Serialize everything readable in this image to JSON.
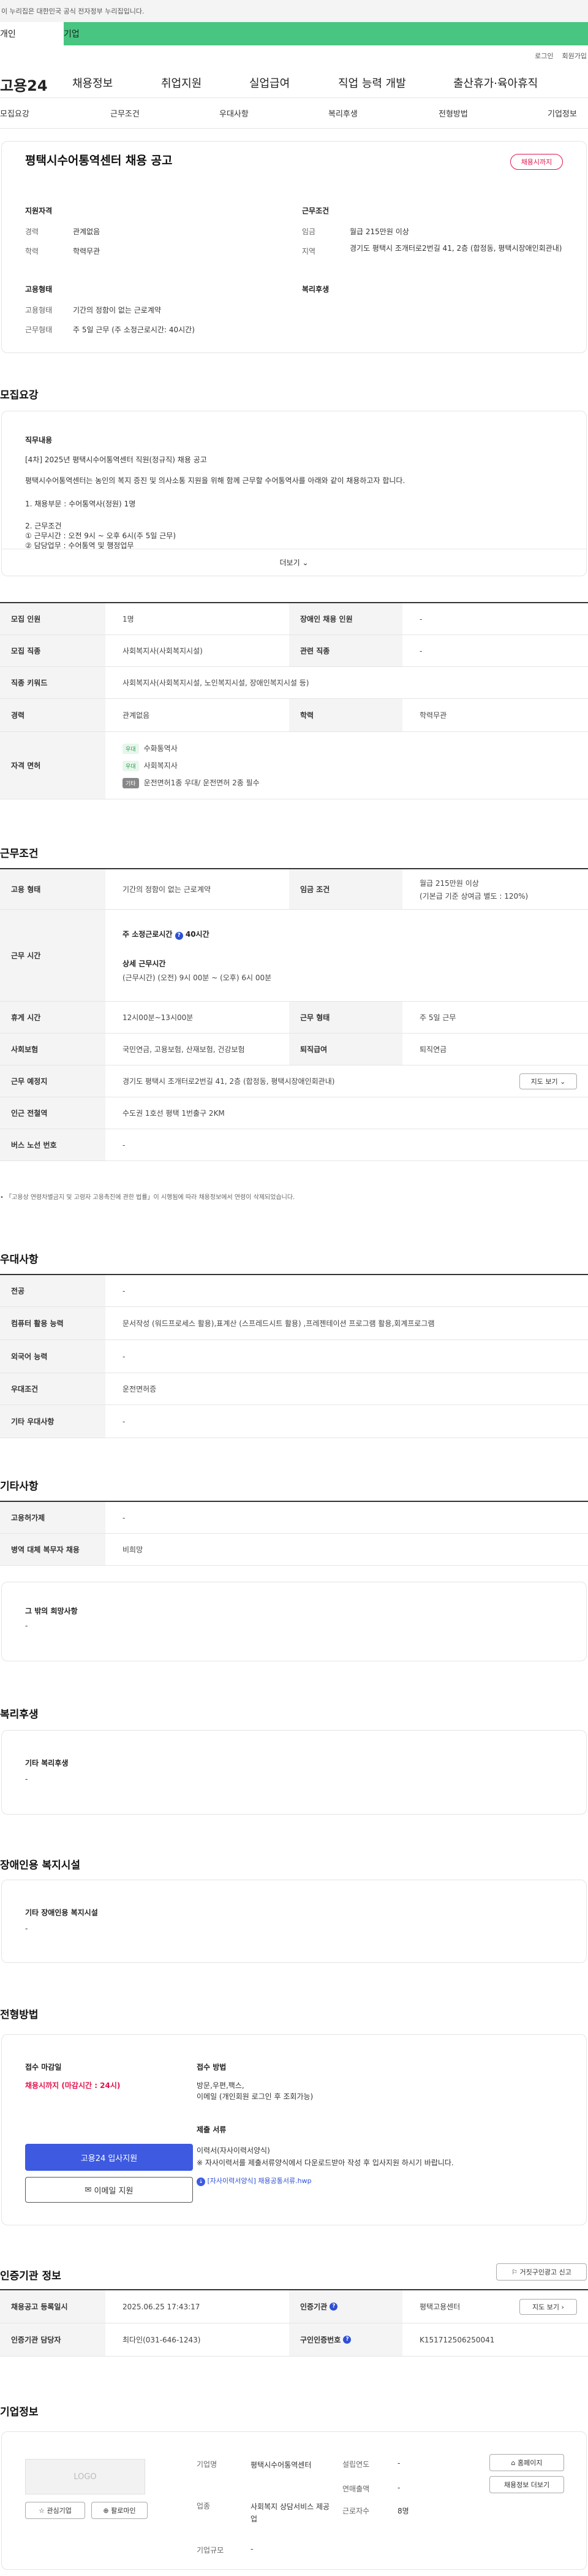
{
  "topbar": {
    "notice": "이 누리집은 대한민국 공식 전자정부 누리집입니다.",
    "tabs": [
      "개인",
      "기업"
    ],
    "login": "로그인",
    "join": "회원가입"
  },
  "gnb": {
    "logo": "고용24",
    "menus": [
      "채용정보",
      "취업지원",
      "실업급여",
      "직업 능력 개발",
      "출산휴가·육아휴직"
    ]
  },
  "lnb": [
    "모집요강",
    "근무조건",
    "우대사항",
    "복리후생",
    "전형방법",
    "기업정보"
  ],
  "job": {
    "title": "평택시수어통역센터 채용 공고",
    "badge": "채용시까지",
    "qual_title": "지원자격",
    "career_label": "경력",
    "career": "관계없음",
    "edu_label": "학력",
    "edu": "학력무관",
    "cond_title": "근무조건",
    "wage_label": "임금",
    "wage": "월급 215만원 이상",
    "area_label": "지역",
    "area": "경기도 평택시 조개터로2번길 41, 2층 (합정동, 평택시장애인회관내)",
    "emp_title": "고용형태",
    "emp_label": "고용형태",
    "emp": "기간의 정함이 없는 근로계약",
    "work_label": "근무형태",
    "work": "주 5일 근무 (주 소정근로시간: 40시간)",
    "welfare_title": "복리후생"
  },
  "recruit": {
    "title": "모집요강",
    "desc_title": "직무내용",
    "desc": [
      "[4차] 2025년 평택시수어통역센터 직원(정규직) 채용 공고",
      "평택시수어통역센터는 농인의 복지 증진 및 의사소통 지원을 위해 함께 근무할 수어통역사를 아래와 같이 채용하고자 합니다.",
      "1. 채용부문 : 수어통역사(정원) 1명",
      "2. 근무조건",
      "① 근무시간 : 오전 9시 ~ 오후 6시(주 5일 근무)",
      "② 담당업무 : 수어통역 및 행정업무"
    ],
    "more": "더보기",
    "rows": [
      {
        "a": "모집 인원",
        "b": "1명",
        "c": "장애인 채용 인원",
        "d": "-"
      },
      {
        "a": "모집 직종",
        "b": "사회복지사(사회복지시설)",
        "c": "관련 직종",
        "d": "-"
      },
      {
        "a": "직종 키워드",
        "b": "사회복지사(사회복지시설, 노인복지시설, 장애인복지시설 등)"
      },
      {
        "a": "경력",
        "b": "관계없음",
        "c": "학력",
        "d": "학력무관"
      }
    ],
    "license_label": "자격 면허",
    "licenses": [
      {
        "tag": "우대",
        "name": "수화통역사"
      },
      {
        "tag": "우대",
        "name": "사회복지사"
      },
      {
        "tag": "기타",
        "name": "운전면허1종 우대/ 운전면허 2종 필수"
      }
    ]
  },
  "conditions": {
    "title": "근무조건",
    "type_label": "고용 형태",
    "type": "기간의 정함이 없는 근로계약",
    "wage_label": "임금 조건",
    "wage": "월급 215만원 이상",
    "wage_note": "(기본급 기준 상여금 별도 : 120%)",
    "hours_label": "근무 시간",
    "hours_title": "주 소정근로시간",
    "hours_value": "40시간",
    "detail_title": "상세 근무시간",
    "detail": "(근무시간) (오전) 9시 00분 ~ (오후) 6시 00분",
    "break_label": "휴게 시간",
    "break": "12시00분~13시00분",
    "form_label": "근무 형태",
    "form": "주 5일 근무",
    "ins_label": "사회보험",
    "ins": "국민연금, 고용보험, 산재보험, 건강보험",
    "ret_label": "퇴직급여",
    "ret": "퇴직연금",
    "place_label": "근무 예정지",
    "place": "경기도 평택시 조개터로2번길 41, 2층 (합정동, 평택시장애인회관내)",
    "map": "지도 보기",
    "subway_label": "인근 전철역",
    "subway": "수도권 1호선 평택 1번출구 2KM",
    "bus_label": "버스 노선 번호",
    "bus": "-",
    "note": "「고용상 연령차별금지 및 고령자 고용촉진에 관한 법률」이 시행됨에 따라 채용정보에서 연령이 삭제되었습니다."
  },
  "pref": {
    "title": "우대사항",
    "rows": [
      {
        "a": "전공",
        "b": "-"
      },
      {
        "a": "컴퓨터 활용 능력",
        "b": "문서작성 (워드프로세스 활용),표계산 (스프레드시트 활용) ,프레젠테이션 프로그램 활용,회계프로그램"
      },
      {
        "a": "외국어 능력",
        "b": "-"
      },
      {
        "a": "우대조건",
        "b": "운전면허증"
      },
      {
        "a": "기타 우대사항",
        "b": "-"
      }
    ]
  },
  "etc": {
    "title": "기타사항",
    "rows": [
      {
        "a": "고용허가제",
        "b": "-"
      },
      {
        "a": "병역 대체 복무자 채용",
        "b": "비희망"
      }
    ],
    "other_title": "그 밖의 희망사항",
    "other": "-"
  },
  "welfare": {
    "title": "복리후생",
    "box_title": "기타 복리후생",
    "box": "-"
  },
  "facility": {
    "title": "장애인용 복지시설",
    "box_title": "기타 장애인용 복지시설",
    "box": "-"
  },
  "process": {
    "title": "전형방법",
    "deadline_title": "접수 마감일",
    "deadline": "채용시까지 (마감시간 : 24시)",
    "apply_btn": "고용24 입사지원",
    "email_btn": "이메일 지원",
    "method_title": "접수 방법",
    "methods": [
      "방문,우편,팩스,",
      "이메일 (개인회원 로그인 후 조회가능)"
    ],
    "docs_title": "제출 서류",
    "docs": [
      "이력서(자사이력서양식)",
      "※ 자사이력서를 제출서류양식에서 다운로드받아 작성 후 입사지원 하시기 바랍니다."
    ],
    "form_link": "[자사이력서양식] 채용공통서류.hwp"
  },
  "agency": {
    "title": "인증기관 정보",
    "report": "거짓구인광고 신고",
    "date_label": "채용공고 등록일시",
    "date": "2025.06.25 17:43:17",
    "org_label": "인증기관",
    "org": "평택고용센터",
    "map": "지도 보기",
    "manager_label": "인증기관 담당자",
    "manager": "최다인(031-646-1243)",
    "no_label": "구인인증번호",
    "no": "K151712506250041"
  },
  "company": {
    "title": "기업정보",
    "logo": "LOGO",
    "fav": "관심기업",
    "follow": "팔로마인",
    "name_label": "기업명",
    "name": "평택시수어통역센터",
    "year_label": "설립연도",
    "year": "-",
    "ind_label": "업종",
    "industry": "사회복지 상담서비스 제공업",
    "sales_label": "연매출액",
    "sales": "-",
    "emp_label": "근로자수",
    "emp": "8명",
    "size_label": "기업규모",
    "size": "-",
    "home": "홈페이지",
    "other": "채용정보 더보기"
  }
}
